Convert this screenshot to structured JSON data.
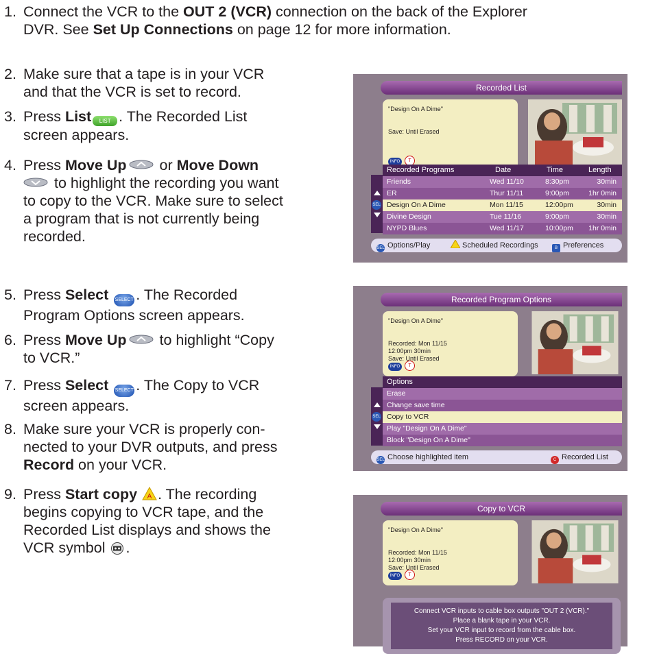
{
  "steps": {
    "s1": {
      "num": "1.",
      "a": "Connect the VCR to the ",
      "b": "OUT 2 (VCR)",
      "c": " connection on the back of the Explorer",
      "d": "DVR. See ",
      "e": "Set Up Connections",
      "f": " on page 12 for more information."
    },
    "s2": {
      "num": "2.",
      "a": "Make sure that a tape is in your VCR",
      "b": "and that the VCR is set to record."
    },
    "s3": {
      "num": "3.",
      "a": "Press ",
      "b": "List",
      "icon": "LIST",
      "c": ". The Recorded List",
      "d": "screen appears."
    },
    "s4": {
      "num": "4.",
      "a": "Press ",
      "b": "Move Up",
      "c": " or ",
      "d": "Move Down",
      "e": " to highlight the recording you want",
      "f": "to copy to the VCR. Make sure to select",
      "g": "a program that is not currently being",
      "h": "recorded."
    },
    "s5": {
      "num": "5.",
      "a": "Press ",
      "b": "Select",
      "icon": "SELECT",
      "c": ". The Recorded",
      "d": "Program Options screen appears."
    },
    "s6": {
      "num": "6.",
      "a": "Press ",
      "b": "Move Up",
      "c": " to highlight “Copy",
      "d": "to VCR.”"
    },
    "s7": {
      "num": "7.",
      "a": "Press ",
      "b": "Select",
      "icon": "SELECT",
      "c": ". The Copy to VCR",
      "d": "screen appears."
    },
    "s8": {
      "num": "8.",
      "a": "Make sure your VCR is properly con-",
      "b": "nected to your DVR outputs, and press",
      "c": "Record",
      "d": " on your VCR."
    },
    "s9": {
      "num": "9.",
      "a": "Press ",
      "b": "Start copy",
      "c": ". The recording",
      "d": "begins copying to VCR tape, and the",
      "e": "Recorded List displays and shows the",
      "f": "VCR symbol ",
      "g": "."
    }
  },
  "screen1": {
    "title": "Recorded List",
    "program": "\"Design On A Dime\"",
    "save": "Save: Until Erased",
    "info": "INFO",
    "headers": [
      "Recorded Programs",
      "Date",
      "Time",
      "Length"
    ],
    "rows": [
      {
        "name": "Friends",
        "date": "Wed 11/10",
        "time": "8:30pm",
        "len": "30min"
      },
      {
        "name": "ER",
        "date": "Thur 11/11",
        "time": "9:00pm",
        "len": "1hr  0min"
      },
      {
        "name": "Design On A Dime",
        "date": "Mon  11/15",
        "time": "12:00pm",
        "len": "30min"
      },
      {
        "name": "Divine Design",
        "date": "Tue  11/16",
        "time": "9:00pm",
        "len": "30min"
      },
      {
        "name": "NYPD Blues",
        "date": "Wed  11/17",
        "time": "10:00pm",
        "len": "1hr  0min"
      }
    ],
    "footer": {
      "f1": "Options/Play",
      "f2": "Scheduled Recordings",
      "f3": "Preferences",
      "b_key": "B",
      "a_key": "A"
    }
  },
  "screen2": {
    "title": "Recorded Program Options",
    "program": "\"Design On A Dime\"",
    "recorded": "Recorded: Mon 11/15",
    "time": "12:00pm  30min",
    "save": "Save: Until Erased",
    "info": "INFO",
    "header": "Options",
    "options": [
      "Erase",
      "Change save time",
      "Copy to VCR",
      "Play \"Design On A Dime\"",
      "Block \"Design On A Dime\""
    ],
    "footer": {
      "f1": "Choose highlighted item",
      "f2": "Recorded List",
      "c_key": "C"
    }
  },
  "screen3": {
    "title": "Copy to VCR",
    "program": "\"Design On A Dime\"",
    "recorded": "Recorded: Mon 11/15",
    "time": "12:00pm  30min",
    "save": "Save: Until Erased",
    "info": "INFO",
    "message": [
      "Connect VCR inputs to cable box outputs \"OUT 2 (VCR).\"",
      "Place a blank tape in your VCR.",
      "Set your VCR input to record from the cable box.",
      "Press RECORD on your VCR."
    ]
  },
  "icons": {
    "sel": "SEL",
    "lock": "T"
  }
}
